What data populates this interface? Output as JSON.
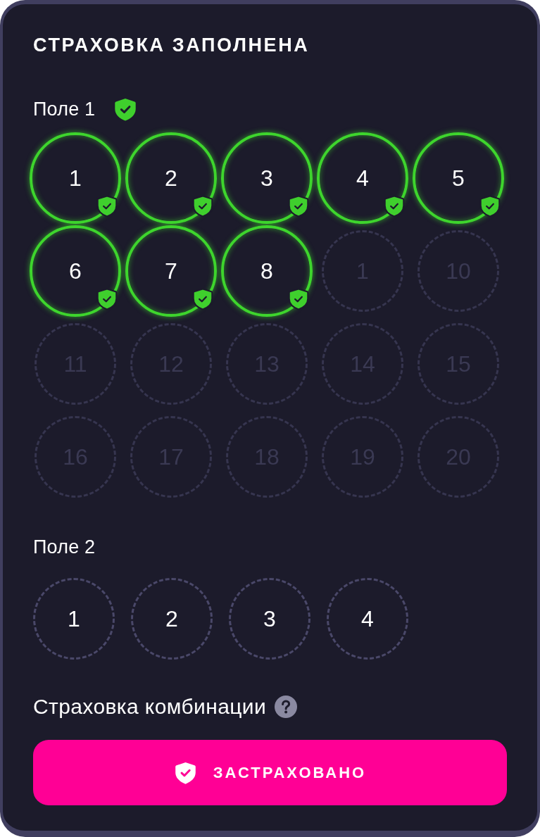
{
  "title": "СТРАХОВКА ЗАПОЛНЕНА",
  "fields": [
    {
      "label": "Поле 1",
      "insured": true,
      "balls": [
        {
          "label": "1",
          "selected": true,
          "disabled": false
        },
        {
          "label": "2",
          "selected": true,
          "disabled": false
        },
        {
          "label": "3",
          "selected": true,
          "disabled": false
        },
        {
          "label": "4",
          "selected": true,
          "disabled": false
        },
        {
          "label": "5",
          "selected": true,
          "disabled": false
        },
        {
          "label": "6",
          "selected": true,
          "disabled": false
        },
        {
          "label": "7",
          "selected": true,
          "disabled": false
        },
        {
          "label": "8",
          "selected": true,
          "disabled": false
        },
        {
          "label": "1",
          "selected": false,
          "disabled": true
        },
        {
          "label": "10",
          "selected": false,
          "disabled": true
        },
        {
          "label": "11",
          "selected": false,
          "disabled": true
        },
        {
          "label": "12",
          "selected": false,
          "disabled": true
        },
        {
          "label": "13",
          "selected": false,
          "disabled": true
        },
        {
          "label": "14",
          "selected": false,
          "disabled": true
        },
        {
          "label": "15",
          "selected": false,
          "disabled": true
        },
        {
          "label": "16",
          "selected": false,
          "disabled": true
        },
        {
          "label": "17",
          "selected": false,
          "disabled": true
        },
        {
          "label": "18",
          "selected": false,
          "disabled": true
        },
        {
          "label": "19",
          "selected": false,
          "disabled": true
        },
        {
          "label": "20",
          "selected": false,
          "disabled": true
        }
      ]
    },
    {
      "label": "Поле 2",
      "insured": false,
      "balls": [
        {
          "label": "1",
          "selected": false,
          "disabled": false
        },
        {
          "label": "2",
          "selected": false,
          "disabled": false
        },
        {
          "label": "3",
          "selected": false,
          "disabled": false
        },
        {
          "label": "4",
          "selected": false,
          "disabled": false
        }
      ]
    }
  ],
  "combination": {
    "label": "Страховка комбинации"
  },
  "button": {
    "label": "ЗАСТРАХОВАНО"
  }
}
